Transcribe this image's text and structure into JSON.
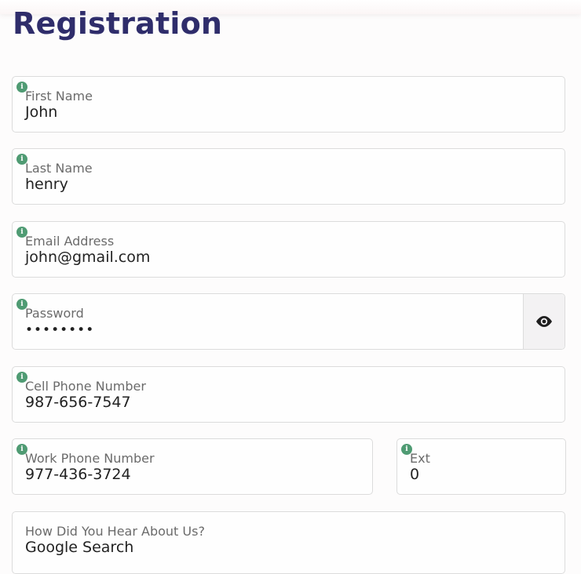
{
  "page": {
    "title": "Registration"
  },
  "icons": {
    "info_glyph": "i",
    "info_color": "#4f9b73",
    "eye_icon": "eye-icon"
  },
  "colors": {
    "title": "#2f2d6b",
    "border": "#dcdcdc"
  },
  "form": {
    "first_name": {
      "label": "First Name",
      "value": "John"
    },
    "last_name": {
      "label": "Last Name",
      "value": "henry"
    },
    "email": {
      "label": "Email Address",
      "value": "john@gmail.com"
    },
    "password": {
      "label": "Password",
      "value": "••••••••"
    },
    "cell_phone": {
      "label": "Cell Phone Number",
      "value": "987-656-7547"
    },
    "work_phone": {
      "label": "Work Phone Number",
      "value": "977-436-3724"
    },
    "ext": {
      "label": "Ext",
      "value": "0"
    },
    "referral": {
      "label": "How Did You Hear About Us?",
      "value": "Google Search"
    }
  }
}
